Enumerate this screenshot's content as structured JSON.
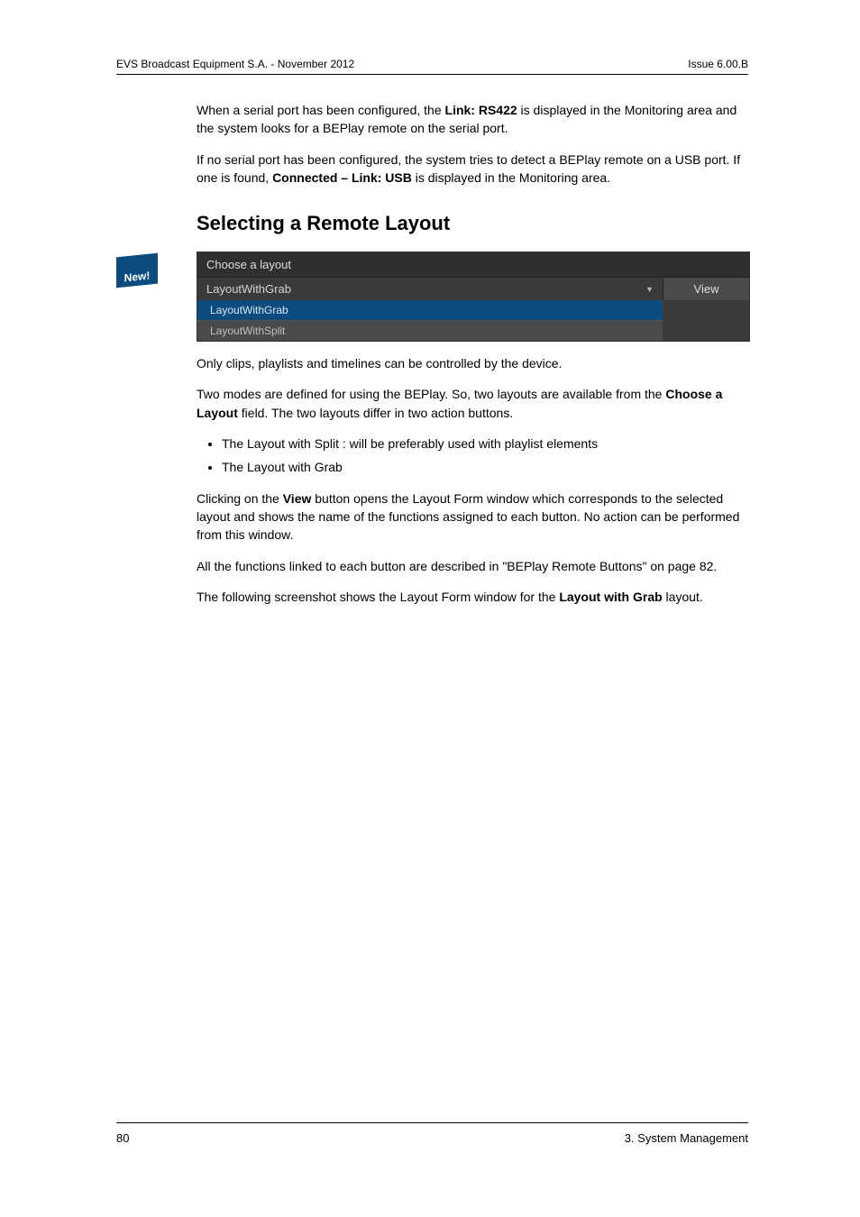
{
  "header": {
    "left": "EVS Broadcast Equipment S.A. - November 2012",
    "right": "Issue 6.00.B"
  },
  "newBadge": "New!",
  "para1": {
    "pre": "When a serial port has been configured, the ",
    "bold": "Link: RS422",
    "post": " is displayed in the Monitoring area and the system looks for a BEPlay remote on the serial port."
  },
  "para2": {
    "pre": "If no serial port has been configured, the system tries to detect a BEPlay remote on a USB port. If one is found, ",
    "bold": "Connected – Link: USB",
    "post": " is displayed in the Monitoring area."
  },
  "heading": "Selecting a Remote Layout",
  "chooser": {
    "label": "Choose a layout",
    "selected": "LayoutWithGrab",
    "viewLabel": "View",
    "options": [
      "LayoutWithGrab",
      "LayoutWithSplit"
    ]
  },
  "para3": "Only clips, playlists and timelines can be controlled by the device.",
  "para4": {
    "pre": "Two modes are defined for using the BEPlay. So, two layouts are available from the ",
    "bold": "Choose a Layout",
    "post": " field. The two layouts differ in two action buttons."
  },
  "bullets": [
    "The Layout with Split : will be preferably used with playlist elements",
    "The Layout with Grab"
  ],
  "para5": {
    "pre": "Clicking on the ",
    "bold": "View",
    "post": " button opens the Layout Form window which corresponds to the selected layout and shows the name of the functions assigned to each button. No action can be performed from this window."
  },
  "para6": "All the functions linked to each button are described in  \"BEPlay Remote Buttons\" on page 82.",
  "para7": {
    "pre": "The following screenshot shows the Layout Form window for the ",
    "bold": "Layout with Grab",
    "post": " layout."
  },
  "footer": {
    "left": "80",
    "right": "3. System Management"
  }
}
